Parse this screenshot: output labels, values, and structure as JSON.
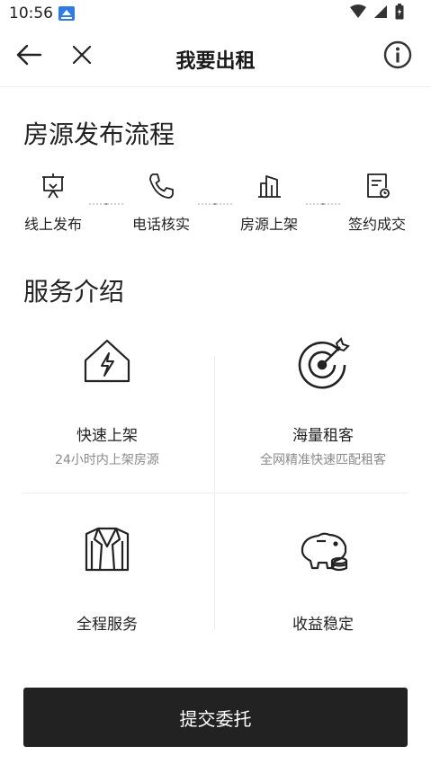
{
  "status_bar": {
    "time": "10:56"
  },
  "header": {
    "title": "我要出租"
  },
  "process": {
    "title": "房源发布流程",
    "steps": [
      {
        "label": "线上发布",
        "icon": "presentation-board-icon"
      },
      {
        "label": "电话核实",
        "icon": "phone-icon"
      },
      {
        "label": "房源上架",
        "icon": "building-icon"
      },
      {
        "label": "签约成交",
        "icon": "contract-document-icon"
      }
    ]
  },
  "services": {
    "title": "服务介绍",
    "items": [
      {
        "name": "快速上架",
        "desc": "24小时内上架房源",
        "icon": "house-lightning-icon"
      },
      {
        "name": "海量租客",
        "desc": "全网精准快速匹配租客",
        "icon": "target-arrow-icon"
      },
      {
        "name": "全程服务",
        "desc": "",
        "icon": "suit-jacket-icon"
      },
      {
        "name": "收益稳定",
        "desc": "",
        "icon": "piggy-bank-coins-icon"
      }
    ]
  },
  "submit": {
    "label": "提交委托"
  },
  "colors": {
    "button_bg": "#222222",
    "text": "#222222",
    "muted": "#8a8a8a",
    "divider": "#ececec"
  }
}
